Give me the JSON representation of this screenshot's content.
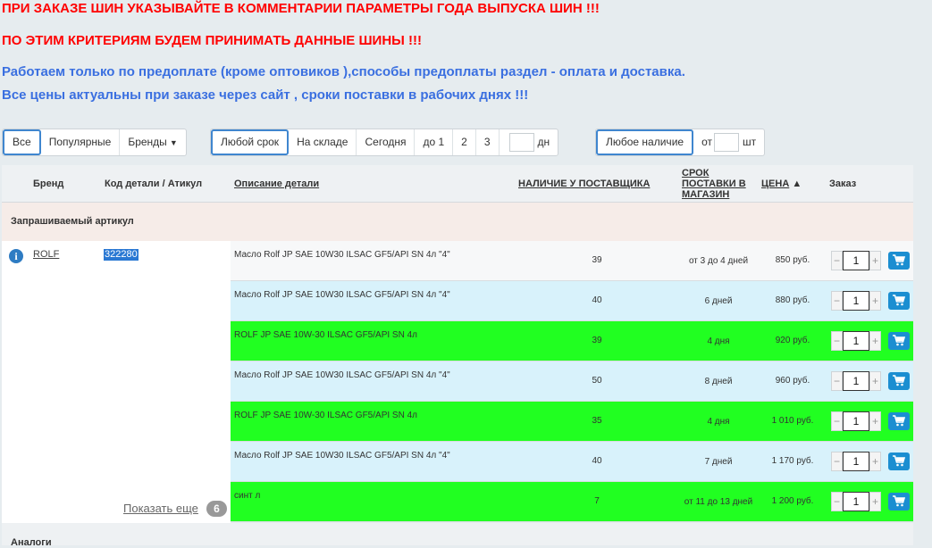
{
  "notices": [
    "ПРИ ЗАКАЗЕ ШИН УКАЗЫВАЙТЕ В КОММЕНТАРИИ  ПАРАМЕТРЫ ГОДА ВЫПУСКА ШИН  !!!",
    "ПО ЭТИМ КРИТЕРИЯМ БУДЕМ ПРИНИМАТЬ ДАННЫЕ ШИНЫ  !!!",
    "Работаем только по предоплате (кроме оптовиков ),способы предоплаты раздел - оплата и доставка.",
    "Все цены актуальны при заказе через сайт , сроки поставки  в рабочих днях !!!"
  ],
  "filters": {
    "brands_group": {
      "all": "Все",
      "popular": "Популярные",
      "brands": "Бренды"
    },
    "term_group": {
      "any": "Любой срок",
      "in_stock": "На складе",
      "today": "Сегодня",
      "up_to_1": "до 1",
      "d2": "2",
      "d3": "3",
      "days_unit": "дн"
    },
    "stock_group": {
      "any": "Любое наличие",
      "from": "от",
      "unit": "шт"
    }
  },
  "table": {
    "headers": {
      "brand": "Бренд",
      "code": "Код детали / Атикул",
      "description": "Описание детали",
      "availability": "НАЛИЧИЕ У ПОСТАВЩИКА",
      "term_1": "СРОК",
      "term_2": "ПОСТАВКИ В",
      "term_3": "МАГАЗИН",
      "price": "ЦЕНА",
      "price_sort": "▲",
      "order": "Заказ"
    },
    "section_requested": "Запрашиваемый артикул",
    "brand": "ROLF",
    "code": "322280",
    "show_more": "Показать еще",
    "show_more_count": "6",
    "rows": [
      {
        "desc": "Масло Rolf JP SAE 10W30 ILSAC GF5/API SN 4л \"4\"",
        "qty": "39",
        "term": "от 3 до 4 дней",
        "price": "850 руб.",
        "order_qty": "1",
        "color": "white"
      },
      {
        "desc": "Масло Rolf JP SAE 10W30 ILSAC GF5/API SN 4л \"4\"",
        "qty": "40",
        "term": "6 дней",
        "price": "880 руб.",
        "order_qty": "1",
        "color": "blue"
      },
      {
        "desc": "ROLF JP SAE 10W-30 ILSAC GF5/API SN 4л",
        "qty": "39",
        "term": "4 дня",
        "price": "920 руб.",
        "order_qty": "1",
        "color": "green"
      },
      {
        "desc": "Масло Rolf JP SAE 10W30 ILSAC GF5/API SN 4л \"4\"",
        "qty": "50",
        "term": "8 дней",
        "price": "960 руб.",
        "order_qty": "1",
        "color": "blue"
      },
      {
        "desc": "ROLF JP SAE 10W-30 ILSAC GF5/API SN 4л",
        "qty": "35",
        "term": "4 дня",
        "price": "1 010 руб.",
        "order_qty": "1",
        "color": "green"
      },
      {
        "desc": "Масло Rolf JP SAE 10W30 ILSAC GF5/API SN 4л \"4\"",
        "qty": "40",
        "term": "7 дней",
        "price": "1 170 руб.",
        "order_qty": "1",
        "color": "blue"
      },
      {
        "desc": "синт л",
        "qty": "7",
        "term": "от 11 до 13 дней",
        "price": "1 200 руб.",
        "order_qty": "1",
        "color": "green"
      }
    ],
    "section_analogs": "Аналоги",
    "icons": {
      "info": "info-icon",
      "cart": "cart-icon",
      "minus": "minus-icon",
      "plus": "plus-icon",
      "caret": "caret-down-icon"
    }
  },
  "colors": {
    "row_white": "#f7f8f9",
    "row_blue": "#d8f2fb",
    "row_green": "#21ff21",
    "accent": "#1b8ed1",
    "warning_red": "#ff0000",
    "info_blue": "#3a6fe0"
  }
}
